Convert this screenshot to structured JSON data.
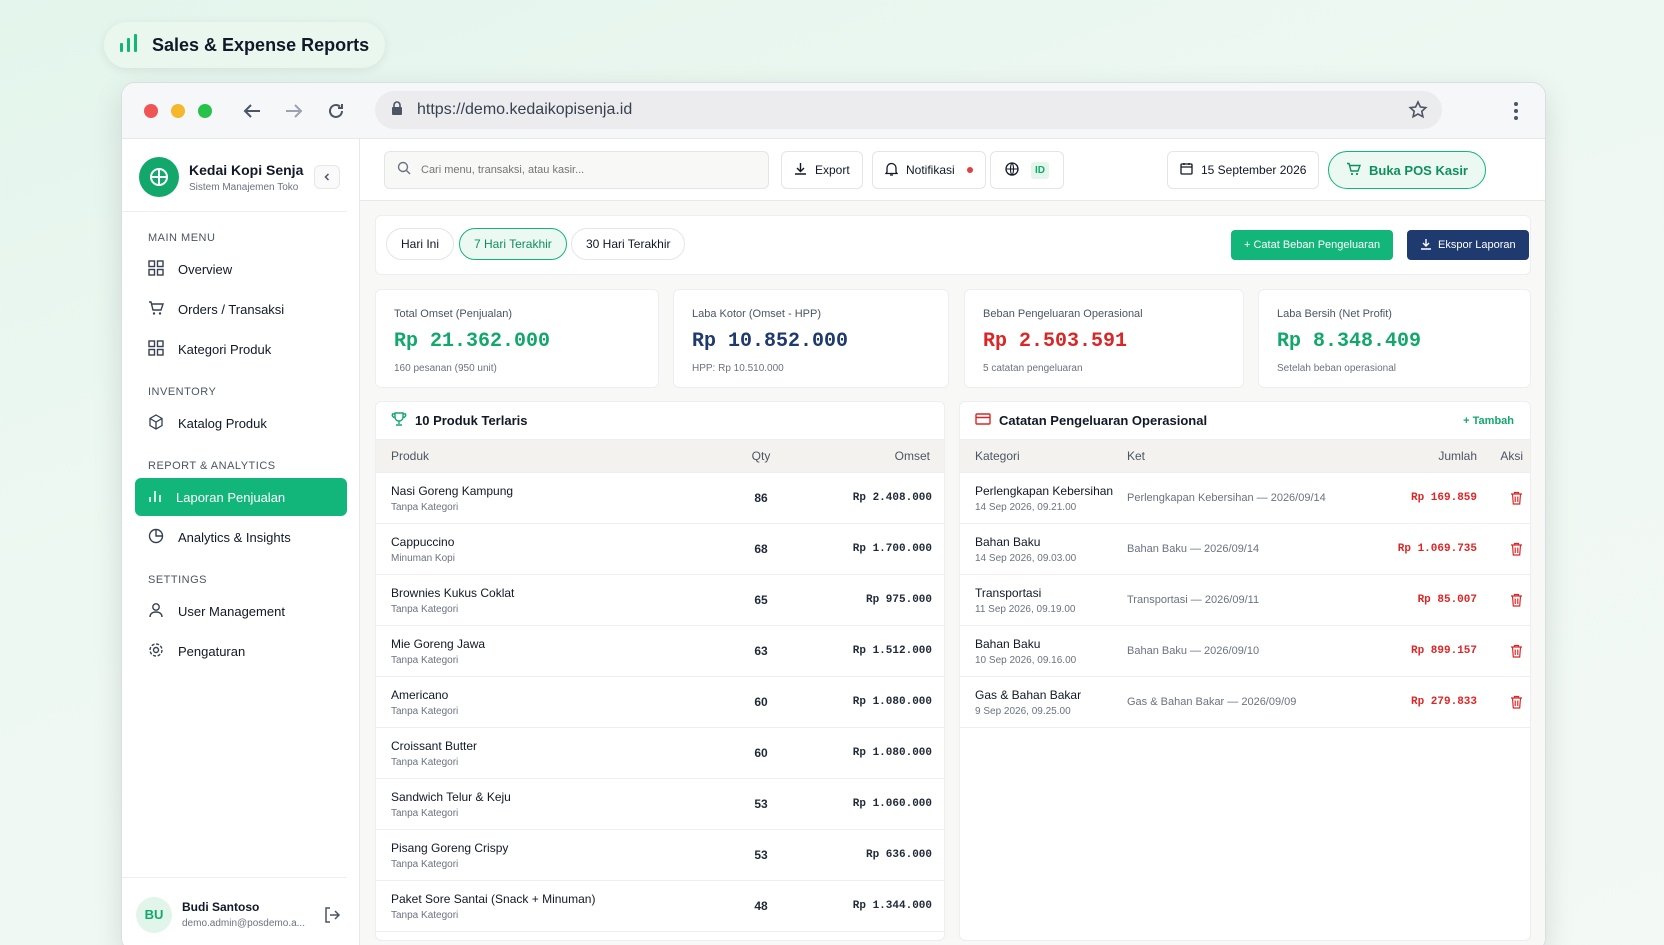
{
  "badge": {
    "title": "Sales & Expense Reports"
  },
  "browser": {
    "url": "https://demo.kedaikopisenja.id"
  },
  "sidebar": {
    "store_name": "Kedai Kopi Senja",
    "store_sub": "Sistem Manajemen Toko",
    "sections": [
      {
        "title": "MAIN MENU"
      },
      {
        "title": "INVENTORY"
      },
      {
        "title": "REPORT & ANALYTICS"
      },
      {
        "title": "SETTINGS"
      }
    ],
    "items": [
      {
        "label": "Overview",
        "icon": "grid-icon"
      },
      {
        "label": "Orders / Transaksi",
        "icon": "cart-icon"
      },
      {
        "label": "Kategori Produk",
        "icon": "grid-icon"
      },
      {
        "label": "Katalog Produk",
        "icon": "box-icon"
      },
      {
        "label": "Laporan Penjualan",
        "icon": "bar-chart-icon",
        "active": true
      },
      {
        "label": "Analytics & Insights",
        "icon": "pie-chart-icon"
      },
      {
        "label": "User Management",
        "icon": "user-icon"
      },
      {
        "label": "Pengaturan",
        "icon": "gear-icon"
      }
    ],
    "user": {
      "initials": "BU",
      "name": "Budi Santoso",
      "email": "demo.admin@posdemo.a..."
    }
  },
  "topbar": {
    "search_placeholder": "Cari menu, transaksi, atau kasir...",
    "export": "Export",
    "notif": "Notifikasi",
    "lang": "ID",
    "date": "15 September 2026",
    "pos": "Buka POS Kasir"
  },
  "filters": {
    "chips": [
      "Hari Ini",
      "7 Hari Terakhir",
      "30 Hari Terakhir"
    ],
    "active_chip": "7 Hari Terakhir",
    "add_expense": "+ Catat Beban Pengeluaran",
    "export_report": "Ekspor Laporan"
  },
  "colors": {
    "accent": "#12b57a",
    "navy": "#1e3a6e",
    "red": "#dc2626"
  },
  "cards": [
    {
      "label": "Total Omset (Penjualan)",
      "value": "Rp 21.362.000",
      "sub": "160 pesanan (950 unit)",
      "color": "#12a86b"
    },
    {
      "label": "Laba Kotor (Omset - HPP)",
      "value": "Rp 10.852.000",
      "sub": "HPP: Rp 10.510.000",
      "color": "#1e3a6e"
    },
    {
      "label": "Beban Pengeluaran Operasional",
      "value": "Rp 2.503.591",
      "sub": "5 catatan pengeluaran",
      "color": "#dc2626"
    },
    {
      "label": "Laba Bersih (Net Profit)",
      "value": "Rp 8.348.409",
      "sub": "Setelah beban operasional",
      "color": "#12a86b"
    }
  ],
  "products": {
    "title": "10 Produk Terlaris",
    "headers": [
      "Produk",
      "Qty",
      "Omset"
    ],
    "rows": [
      {
        "name": "Nasi Goreng Kampung",
        "cat": "Tanpa Kategori",
        "qty": "86",
        "omset": "Rp 2.408.000"
      },
      {
        "name": "Cappuccino",
        "cat": "Minuman Kopi",
        "qty": "68",
        "omset": "Rp 1.700.000"
      },
      {
        "name": "Brownies Kukus Coklat",
        "cat": "Tanpa Kategori",
        "qty": "65",
        "omset": "Rp 975.000"
      },
      {
        "name": "Mie Goreng Jawa",
        "cat": "Tanpa Kategori",
        "qty": "63",
        "omset": "Rp 1.512.000"
      },
      {
        "name": "Americano",
        "cat": "Tanpa Kategori",
        "qty": "60",
        "omset": "Rp 1.080.000"
      },
      {
        "name": "Croissant Butter",
        "cat": "Tanpa Kategori",
        "qty": "60",
        "omset": "Rp 1.080.000"
      },
      {
        "name": "Sandwich Telur & Keju",
        "cat": "Tanpa Kategori",
        "qty": "53",
        "omset": "Rp 1.060.000"
      },
      {
        "name": "Pisang Goreng Crispy",
        "cat": "Tanpa Kategori",
        "qty": "53",
        "omset": "Rp 636.000"
      },
      {
        "name": "Paket Sore Santai (Snack + Minuman)",
        "cat": "Tanpa Kategori",
        "qty": "48",
        "omset": "Rp 1.344.000"
      }
    ]
  },
  "expenses": {
    "title": "Catatan Pengeluaran Operasional",
    "add": "+ Tambah",
    "headers": [
      "Kategori",
      "Ket",
      "Jumlah",
      "Aksi"
    ],
    "rows": [
      {
        "cat": "Perlengkapan Kebersihan",
        "time": "14 Sep 2026, 09.21.00",
        "ket": "Perlengkapan Kebersihan — 2026/09/14",
        "amount": "Rp 169.859"
      },
      {
        "cat": "Bahan Baku",
        "time": "14 Sep 2026, 09.03.00",
        "ket": "Bahan Baku — 2026/09/14",
        "amount": "Rp 1.069.735"
      },
      {
        "cat": "Transportasi",
        "time": "11 Sep 2026, 09.19.00",
        "ket": "Transportasi — 2026/09/11",
        "amount": "Rp 85.007"
      },
      {
        "cat": "Bahan Baku",
        "time": "10 Sep 2026, 09.16.00",
        "ket": "Bahan Baku — 2026/09/10",
        "amount": "Rp 899.157"
      },
      {
        "cat": "Gas & Bahan Bakar",
        "time": "9 Sep 2026, 09.25.00",
        "ket": "Gas & Bahan Bakar — 2026/09/09",
        "amount": "Rp 279.833"
      }
    ]
  }
}
